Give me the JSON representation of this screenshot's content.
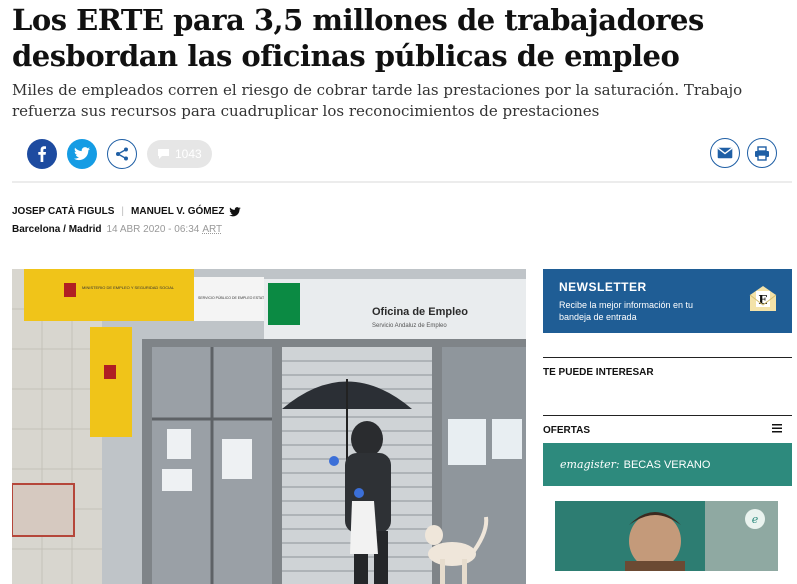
{
  "article": {
    "headline": "Los ERTE para 3,5 millones de trabajadores desbordan las oficinas públicas de empleo",
    "subheadline": "Miles de empleados corren el riesgo de cobrar tarde las prestaciones por la saturación. Trabajo refuerza sus recursos para cuadruplicar los reconocimientos de prestaciones",
    "authors": [
      "JOSEP CATÀ FIGULS",
      "MANUEL V. GÓMEZ"
    ],
    "location": "Barcelona / Madrid",
    "date": "14 ABR 2020 - 06:34",
    "timezone": "ART"
  },
  "share": {
    "comments_count": "1043"
  },
  "photo": {
    "sign_left_1": "MINISTERIO DE EMPLEO Y SEGURIDAD SOCIAL",
    "sign_left_2": "SERVICIO PÚBLICO DE EMPLEO ESTATAL",
    "sign_main": "Oficina de Empleo",
    "sign_sub": "Servicio Andaluz de Empleo"
  },
  "sidebar": {
    "newsletter_title": "NEWSLETTER",
    "newsletter_text": "Recibe la mejor información en tu bandeja de entrada",
    "interest_title": "TE PUEDE INTERESAR",
    "offers_title": "OFERTAS",
    "becas_brand": "emagister:",
    "becas_label": "BECAS VERANO"
  },
  "colors": {
    "facebook": "#1d4ba0",
    "twitter": "#159ce4",
    "accent_blue": "#1f5d95",
    "emagister_green": "#2d8a7d"
  }
}
